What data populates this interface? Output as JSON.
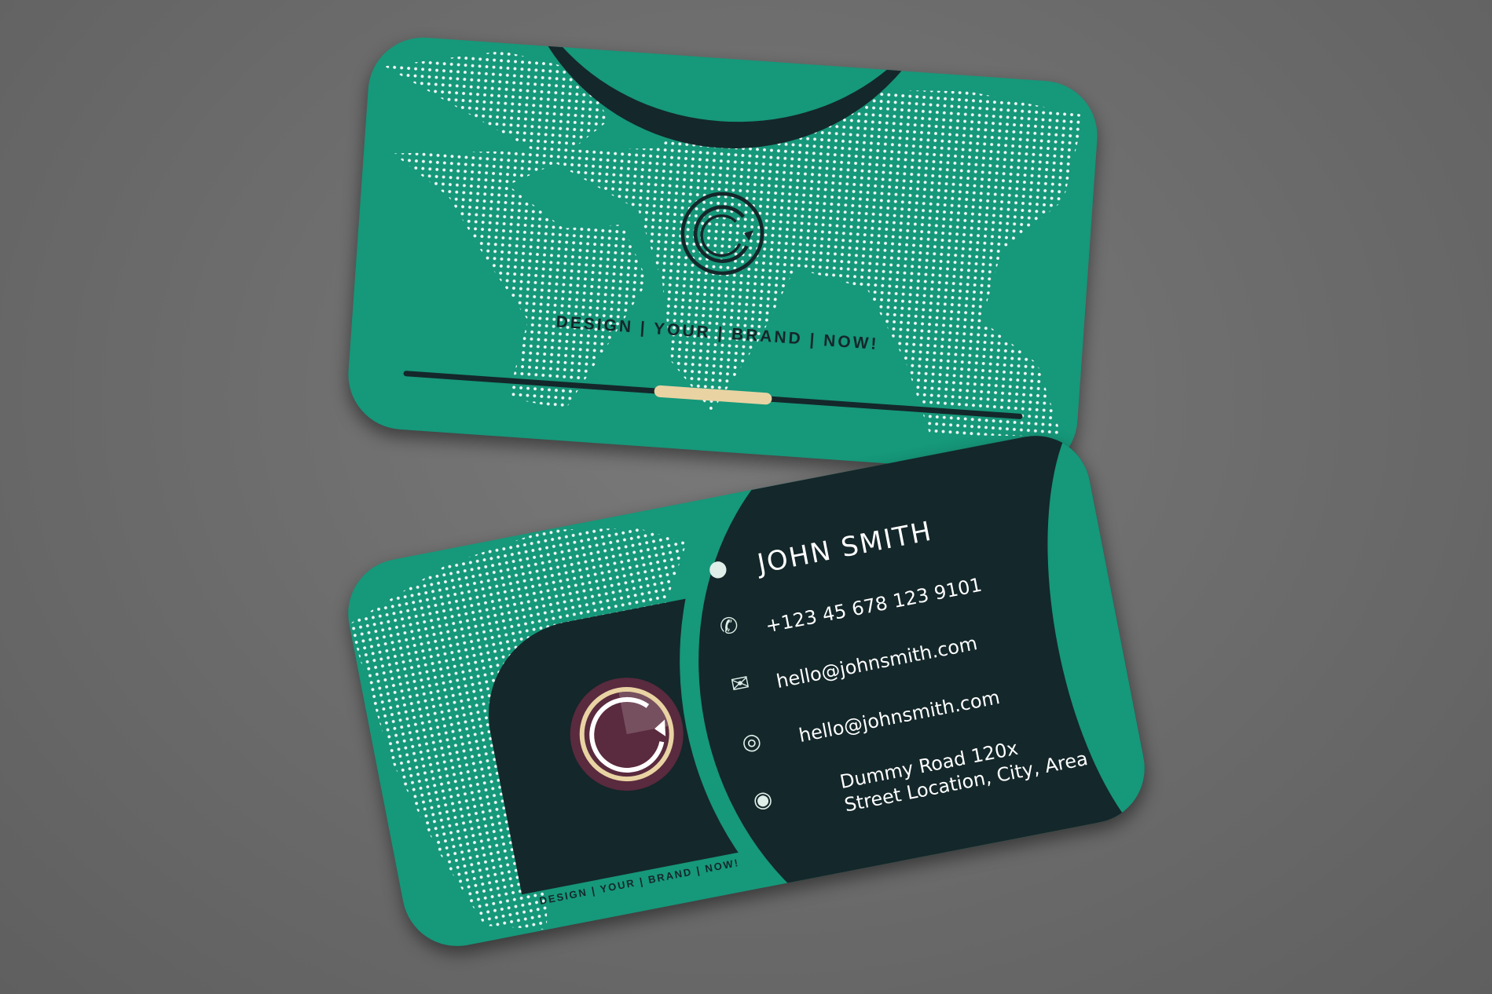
{
  "back_card": {
    "tagline": "DESIGN  |  YOUR  |  BRAND  |  NOW!",
    "logo": "c-logo"
  },
  "front_card": {
    "name": "JOHN SMITH",
    "phone": "+123 45 678 123 9101",
    "email_1": "hello@johnsmith.com",
    "email_2": "hello@johnsmith.com",
    "address_line_1": "Dummy Road 120x",
    "address_line_2": "Street Location, City, Area",
    "tagline": "DESIGN  |  YOUR  |  BRAND  |  NOW!",
    "icons": [
      "person-icon",
      "phone-icon",
      "mail-icon",
      "globe-icon",
      "location-pin-icon"
    ]
  },
  "colors": {
    "card_green": "#16987a",
    "dark": "#14272a",
    "accent_cream": "#e9d3a3",
    "logo_maroon": "#5a2a3e",
    "background_gray": "#6b6b6b"
  }
}
